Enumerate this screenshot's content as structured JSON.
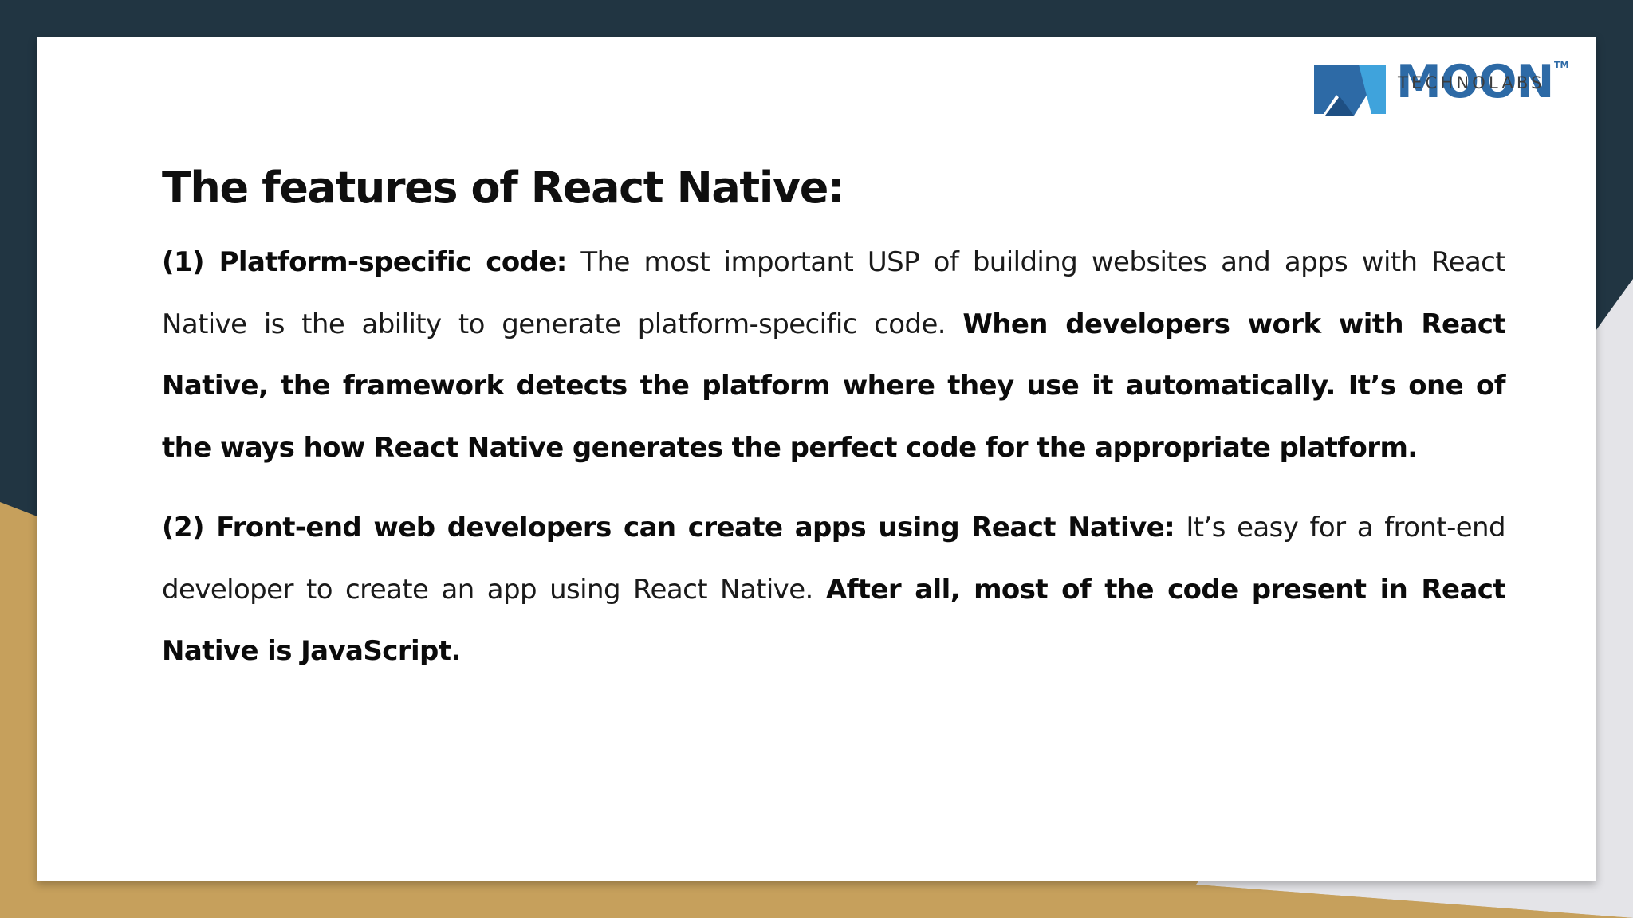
{
  "brand": {
    "name": "MOON",
    "trademark": "TM",
    "subtitle": "TECHNOLABS",
    "color": "#2d6aa6"
  },
  "colors": {
    "background_dark": "#213542",
    "background_gold": "#c6a05c",
    "background_light": "#e4e4e8",
    "card": "#ffffff"
  },
  "slide": {
    "heading": "The features of React Native:",
    "paragraphs": [
      {
        "lead": "(1) Platform-specific code:",
        "text": " The most important USP of building websites and apps with React Native is the ability to generate platform-specific code. ",
        "emphasis": "When developers work with React Native, the framework detects the platform where they use it automatically. It’s one of the ways how React Native generates the perfect code for the appropriate platform."
      },
      {
        "lead": "(2) Front-end web developers can create apps using React Native:",
        "text": " It’s easy for a front-end developer to create an app using React Native. ",
        "emphasis": "After all, most of the code present in React Native is JavaScript."
      }
    ]
  }
}
